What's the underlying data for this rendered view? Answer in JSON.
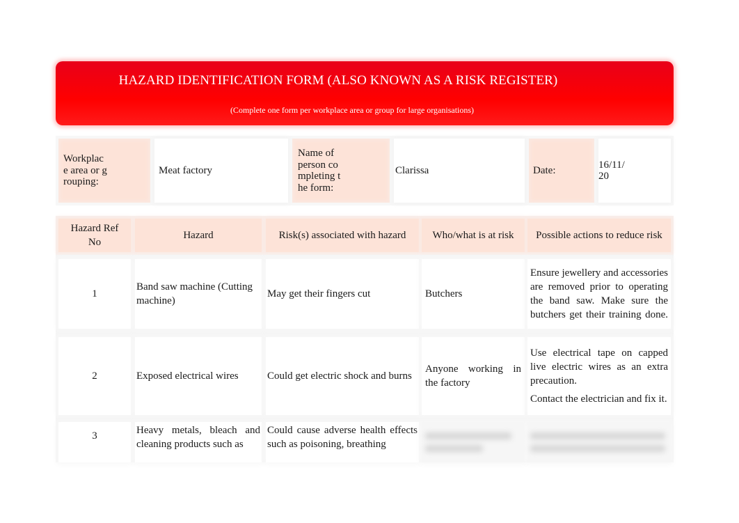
{
  "banner": {
    "title": "HAZARD IDENTIFICATION FORM (ALSO KNOWN AS A RISK REGISTER)",
    "subtitle": "(Complete one form per workplace area or group for large organisations)",
    "color": "#ff0000"
  },
  "info": {
    "workplace_label": "Workplace area or grouping:",
    "workplace_value": "Meat factory",
    "person_label": "Name of person completing the form:",
    "person_value": "Clarissa",
    "date_label": "Date:",
    "date_value": "16/11/20"
  },
  "table": {
    "headers": [
      "Hazard Ref No",
      "Hazard",
      "Risk(s) associated with hazard",
      "Who/what is at risk",
      "Possible actions to reduce risk"
    ],
    "rows": [
      {
        "ref": "1",
        "hazard": "Band saw machine (Cutting machine)",
        "risk": "May get their fingers cut",
        "who": "Butchers",
        "actions": [
          "Ensure jewellery and accessories are removed prior to operating the band saw. Make sure the butchers get their training done."
        ]
      },
      {
        "ref": "2",
        "hazard": "Exposed electrical wires",
        "risk": "Could get electric shock and burns",
        "who": "Anyone working in the factory",
        "actions": [
          "Use electrical tape on capped live electric wires as an extra precaution.",
          "Contact the electrician and fix it."
        ]
      },
      {
        "ref": "3",
        "hazard": "Heavy metals, bleach and cleaning products such as",
        "risk": "Could cause adverse health effects such as poisoning, breathing",
        "who": "",
        "actions": []
      }
    ]
  },
  "colors": {
    "label_bg": "#fde3d8",
    "banner_red": "#ff0000"
  }
}
